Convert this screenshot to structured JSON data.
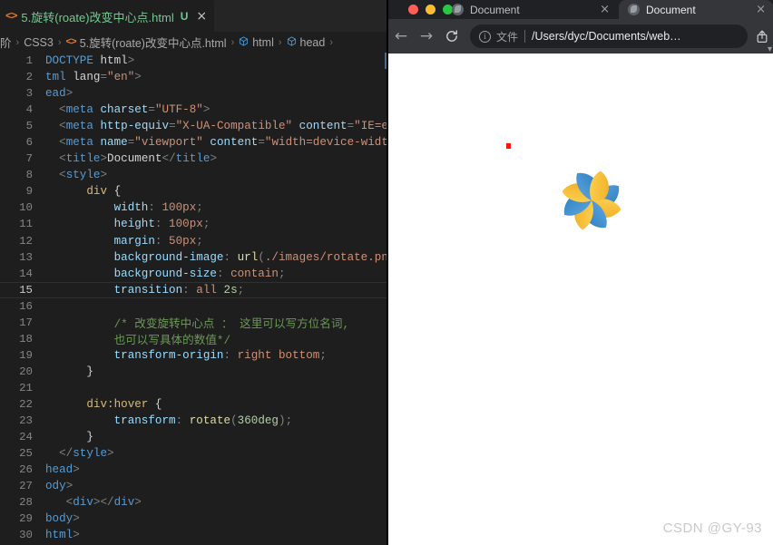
{
  "editor": {
    "tab": {
      "icon": "html-file-icon",
      "filename": "5.旋转(roate)改变中心点.html",
      "status_badge": "U",
      "close": "×"
    },
    "breadcrumb": {
      "items": [
        {
          "label": "阶",
          "icon": ""
        },
        {
          "label": "CSS3",
          "icon": ""
        },
        {
          "label": "5.旋转(roate)改变中心点.html",
          "icon": "html-file-icon"
        },
        {
          "label": "html",
          "icon": "cube-icon"
        },
        {
          "label": "head",
          "icon": "cube-icon"
        }
      ],
      "separator": "›"
    },
    "active_line": 15,
    "lines": [
      {
        "n": 1,
        "tokens": [
          {
            "t": "tag",
            "v": "DOCTYPE "
          },
          {
            "t": "plain",
            "v": "html"
          },
          {
            "t": "punc",
            "v": ">"
          }
        ]
      },
      {
        "n": 2,
        "tokens": [
          {
            "t": "tagname",
            "v": "tml "
          },
          {
            "t": "plain",
            "v": "lang"
          },
          {
            "t": "punc",
            "v": "="
          },
          {
            "t": "str",
            "v": "\"en\""
          },
          {
            "t": "punc",
            "v": ">"
          }
        ]
      },
      {
        "n": 3,
        "tokens": [
          {
            "t": "tagname",
            "v": "ead"
          },
          {
            "t": "punc",
            "v": ">"
          }
        ]
      },
      {
        "n": 4,
        "tokens": [
          {
            "t": "punc",
            "v": "  <"
          },
          {
            "t": "tagname",
            "v": "meta "
          },
          {
            "t": "attr",
            "v": "charset"
          },
          {
            "t": "punc",
            "v": "="
          },
          {
            "t": "str",
            "v": "\"UTF-8\""
          },
          {
            "t": "punc",
            "v": ">"
          }
        ]
      },
      {
        "n": 5,
        "tokens": [
          {
            "t": "punc",
            "v": "  <"
          },
          {
            "t": "tagname",
            "v": "meta "
          },
          {
            "t": "attr",
            "v": "http-equiv"
          },
          {
            "t": "punc",
            "v": "="
          },
          {
            "t": "str",
            "v": "\"X-UA-Compatible\""
          },
          {
            "t": "plain",
            "v": " "
          },
          {
            "t": "attr",
            "v": "content"
          },
          {
            "t": "punc",
            "v": "="
          },
          {
            "t": "str",
            "v": "\"IE=edg"
          }
        ]
      },
      {
        "n": 6,
        "tokens": [
          {
            "t": "punc",
            "v": "  <"
          },
          {
            "t": "tagname",
            "v": "meta "
          },
          {
            "t": "attr",
            "v": "name"
          },
          {
            "t": "punc",
            "v": "="
          },
          {
            "t": "str",
            "v": "\"viewport\""
          },
          {
            "t": "plain",
            "v": " "
          },
          {
            "t": "attr",
            "v": "content"
          },
          {
            "t": "punc",
            "v": "="
          },
          {
            "t": "str",
            "v": "\"width=device-width"
          }
        ]
      },
      {
        "n": 7,
        "tokens": [
          {
            "t": "punc",
            "v": "  <"
          },
          {
            "t": "tagname",
            "v": "title"
          },
          {
            "t": "punc",
            "v": ">"
          },
          {
            "t": "text",
            "v": "Document"
          },
          {
            "t": "punc",
            "v": "</"
          },
          {
            "t": "tagname",
            "v": "title"
          },
          {
            "t": "punc",
            "v": ">"
          }
        ]
      },
      {
        "n": 8,
        "tokens": [
          {
            "t": "punc",
            "v": "  <"
          },
          {
            "t": "tagname",
            "v": "style"
          },
          {
            "t": "punc",
            "v": ">"
          }
        ]
      },
      {
        "n": 9,
        "tokens": [
          {
            "t": "sel",
            "v": "      div "
          },
          {
            "t": "brace",
            "v": "{"
          }
        ]
      },
      {
        "n": 10,
        "tokens": [
          {
            "t": "prop",
            "v": "          width"
          },
          {
            "t": "punc",
            "v": ": "
          },
          {
            "t": "val",
            "v": "100px"
          },
          {
            "t": "punc",
            "v": ";"
          }
        ]
      },
      {
        "n": 11,
        "tokens": [
          {
            "t": "prop",
            "v": "          height"
          },
          {
            "t": "punc",
            "v": ": "
          },
          {
            "t": "val",
            "v": "100px"
          },
          {
            "t": "punc",
            "v": ";"
          }
        ]
      },
      {
        "n": 12,
        "tokens": [
          {
            "t": "prop",
            "v": "          margin"
          },
          {
            "t": "punc",
            "v": ": "
          },
          {
            "t": "val",
            "v": "50px"
          },
          {
            "t": "punc",
            "v": ";"
          }
        ]
      },
      {
        "n": 13,
        "tokens": [
          {
            "t": "prop",
            "v": "          background-image"
          },
          {
            "t": "punc",
            "v": ": "
          },
          {
            "t": "fn",
            "v": "url"
          },
          {
            "t": "punc",
            "v": "("
          },
          {
            "t": "val",
            "v": "./images/rotate.png"
          }
        ]
      },
      {
        "n": 14,
        "tokens": [
          {
            "t": "prop",
            "v": "          background-size"
          },
          {
            "t": "punc",
            "v": ": "
          },
          {
            "t": "val",
            "v": "contain"
          },
          {
            "t": "punc",
            "v": ";"
          }
        ]
      },
      {
        "n": 15,
        "tokens": [
          {
            "t": "prop",
            "v": "          transition"
          },
          {
            "t": "punc",
            "v": ": "
          },
          {
            "t": "val",
            "v": "all "
          },
          {
            "t": "num",
            "v": "2s"
          },
          {
            "t": "punc",
            "v": ";"
          }
        ]
      },
      {
        "n": 16,
        "tokens": []
      },
      {
        "n": 17,
        "tokens": [
          {
            "t": "com",
            "v": "          /* 改变旋转中心点 ： 这里可以写方位名词,"
          }
        ]
      },
      {
        "n": 18,
        "tokens": [
          {
            "t": "com",
            "v": "          也可以写具体的数值*/"
          }
        ]
      },
      {
        "n": 19,
        "tokens": [
          {
            "t": "prop",
            "v": "          transform-origin"
          },
          {
            "t": "punc",
            "v": ": "
          },
          {
            "t": "val",
            "v": "right bottom"
          },
          {
            "t": "punc",
            "v": ";"
          }
        ]
      },
      {
        "n": 20,
        "tokens": [
          {
            "t": "brace",
            "v": "      }"
          }
        ]
      },
      {
        "n": 21,
        "tokens": []
      },
      {
        "n": 22,
        "tokens": [
          {
            "t": "sel",
            "v": "      div:hover "
          },
          {
            "t": "brace",
            "v": "{"
          }
        ]
      },
      {
        "n": 23,
        "tokens": [
          {
            "t": "prop",
            "v": "          transform"
          },
          {
            "t": "punc",
            "v": ": "
          },
          {
            "t": "fn",
            "v": "rotate"
          },
          {
            "t": "punc",
            "v": "("
          },
          {
            "t": "num",
            "v": "360deg"
          },
          {
            "t": "punc",
            "v": ")"
          },
          {
            "t": "punc",
            "v": ";"
          }
        ]
      },
      {
        "n": 24,
        "tokens": [
          {
            "t": "brace",
            "v": "      }"
          }
        ]
      },
      {
        "n": 25,
        "tokens": [
          {
            "t": "punc",
            "v": "  </"
          },
          {
            "t": "tagname",
            "v": "style"
          },
          {
            "t": "punc",
            "v": ">"
          }
        ]
      },
      {
        "n": 26,
        "tokens": [
          {
            "t": "tagname",
            "v": "head"
          },
          {
            "t": "punc",
            "v": ">"
          }
        ]
      },
      {
        "n": 27,
        "tokens": [
          {
            "t": "tagname",
            "v": "ody"
          },
          {
            "t": "punc",
            "v": ">"
          }
        ]
      },
      {
        "n": 28,
        "tokens": [
          {
            "t": "punc",
            "v": "   <"
          },
          {
            "t": "tagname",
            "v": "div"
          },
          {
            "t": "punc",
            "v": "></"
          },
          {
            "t": "tagname",
            "v": "div"
          },
          {
            "t": "punc",
            "v": ">"
          }
        ]
      },
      {
        "n": 29,
        "tokens": [
          {
            "t": "tagname",
            "v": "body"
          },
          {
            "t": "punc",
            "v": ">"
          }
        ]
      },
      {
        "n": 30,
        "tokens": [
          {
            "t": "tagname",
            "v": "html"
          },
          {
            "t": "punc",
            "v": ">"
          }
        ]
      }
    ]
  },
  "browser": {
    "traffic_lights": [
      "close",
      "minimize",
      "maximize"
    ],
    "tabs": [
      {
        "title": "Document",
        "active": false,
        "close": "×"
      },
      {
        "title": "Document",
        "active": true,
        "close": "×"
      }
    ],
    "toolbar": {
      "back": "←",
      "forward": "→",
      "reload": "⟳",
      "omnibox": {
        "info_icon": "i",
        "scheme_label": "文件",
        "url": "/Users/dyc/Documents/web…"
      },
      "share": "share-icon"
    },
    "page": {
      "watermark": "CSDN @GY-93",
      "red_dot": "origin-marker",
      "image_alt": "rotate.png pinwheel"
    }
  },
  "colors": {
    "editor_bg": "#1e1e1e",
    "tab_active_text": "#73c991",
    "html_icon": "#e37933",
    "browser_chrome": "#35363a",
    "browser_tabstrip": "#202124",
    "petal_blue": "#3d8fd1",
    "petal_yellow": "#f5c23e",
    "red_dot": "#fc1808",
    "watermark": "#c9c9c9"
  }
}
